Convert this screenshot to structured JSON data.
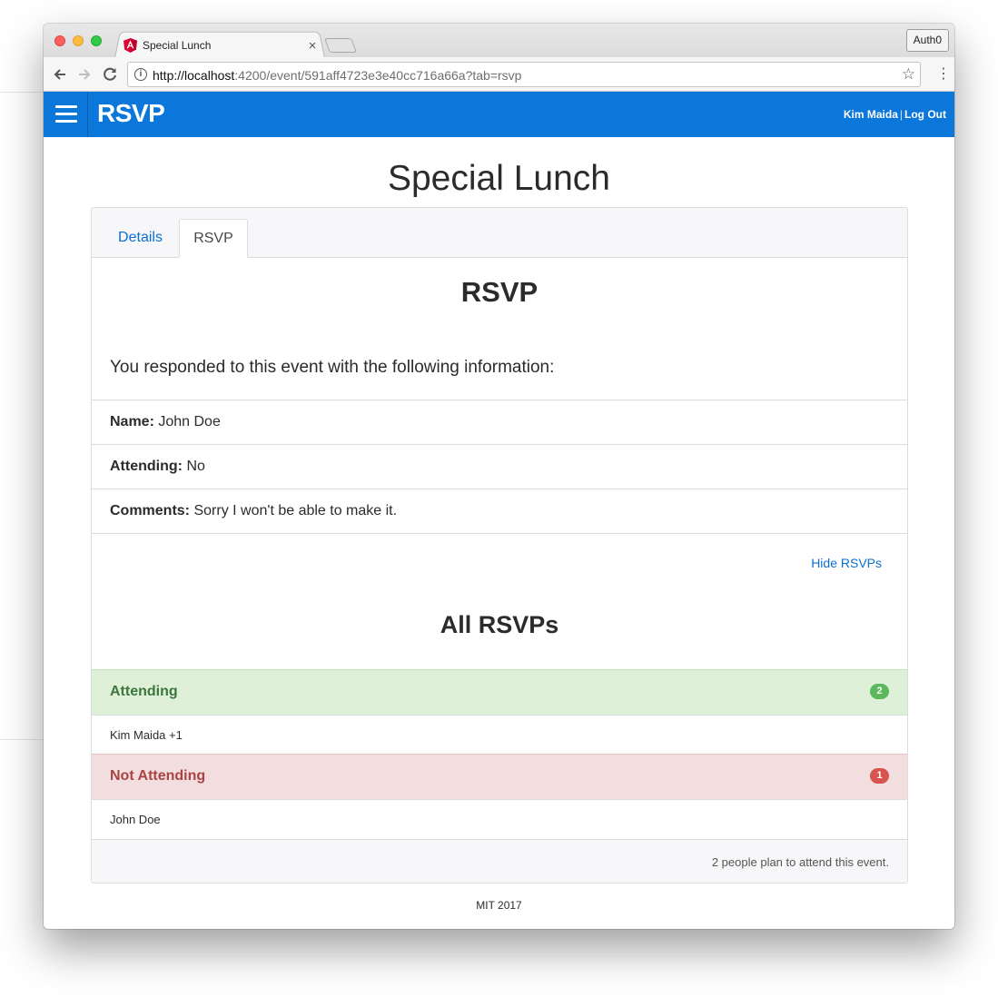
{
  "browser": {
    "tab_title": "Special Lunch",
    "tab_close": "×",
    "profile_label": "Auth0",
    "url_host": "http://localhost",
    "url_rest": ":4200/event/591aff4723e3e40cc716a66a?tab=rsvp"
  },
  "header": {
    "brand": "RSVP",
    "user_name": "Kim Maida",
    "separator": "|",
    "logout_label": "Log Out"
  },
  "page": {
    "title": "Special Lunch",
    "tabs": [
      {
        "label": "Details",
        "active": false
      },
      {
        "label": "RSVP",
        "active": true
      }
    ]
  },
  "rsvp": {
    "heading": "RSVP",
    "lead": "You responded to this event with the following information:",
    "fields": [
      {
        "label": "Name:",
        "value": "John Doe"
      },
      {
        "label": "Attending:",
        "value": "No"
      },
      {
        "label": "Comments:",
        "value": "Sorry I won't be able to make it."
      }
    ],
    "hide_link": "Hide RSVPs"
  },
  "all_rsvps": {
    "heading": "All RSVPs",
    "attending": {
      "label": "Attending",
      "count": "2",
      "names": [
        "Kim Maida +1"
      ]
    },
    "not_attending": {
      "label": "Not Attending",
      "count": "1",
      "names": [
        "John Doe"
      ]
    },
    "footer": "2 people plan to attend this event."
  },
  "footer": {
    "text": "MIT 2017"
  },
  "colors": {
    "header_blue": "#0b77db",
    "link_blue": "#0b6fd1",
    "success_bg": "#dff0d8",
    "success_text": "#3c763d",
    "danger_bg": "#f2dede",
    "danger_text": "#a94442"
  },
  "icons": [
    "angular-favicon-icon",
    "back-arrow-icon",
    "forward-arrow-icon",
    "reload-icon",
    "info-icon",
    "star-icon",
    "menu-dots-icon",
    "hamburger-icon"
  ]
}
